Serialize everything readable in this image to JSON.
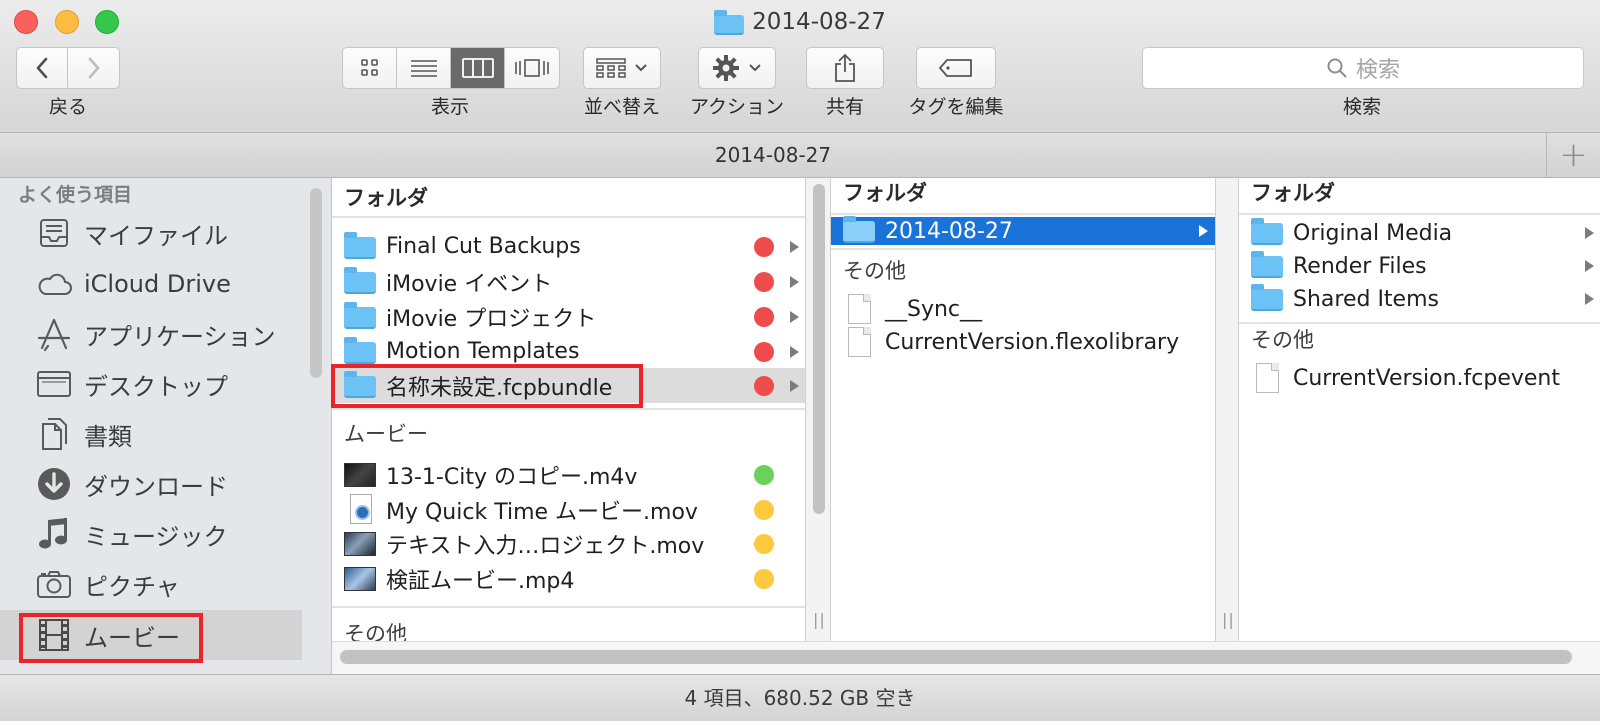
{
  "window": {
    "title": "2014-08-27"
  },
  "toolbar": {
    "back_label": "戻る",
    "view_label": "表示",
    "arrange_label": "並べ替え",
    "action_label": "アクション",
    "share_label": "共有",
    "tags_label": "タグを編集",
    "search_label": "検索",
    "search_placeholder": "検索"
  },
  "pathbar": {
    "title": "2014-08-27",
    "add_symbol": "+"
  },
  "sidebar": {
    "section_title": "よく使う項目",
    "items": [
      {
        "label": "マイファイル",
        "icon": "all-files-icon"
      },
      {
        "label": "iCloud Drive",
        "icon": "cloud-icon"
      },
      {
        "label": "アプリケーション",
        "icon": "applications-icon"
      },
      {
        "label": "デスクトップ",
        "icon": "desktop-icon"
      },
      {
        "label": "書類",
        "icon": "documents-icon"
      },
      {
        "label": "ダウンロード",
        "icon": "download-icon"
      },
      {
        "label": "ミュージック",
        "icon": "music-icon"
      },
      {
        "label": "ピクチャ",
        "icon": "camera-icon"
      },
      {
        "label": "ムービー",
        "icon": "film-icon",
        "selected": true
      }
    ]
  },
  "column1": {
    "folders_header": "フォルダ",
    "folders": [
      {
        "name": "Final Cut Backups",
        "tag": "#ee4b4d"
      },
      {
        "name": "iMovie イベント",
        "tag": "#ee4b4d"
      },
      {
        "name": "iMovie プロジェクト",
        "tag": "#ee4b4d"
      },
      {
        "name": "Motion Templates",
        "tag": "#ee4b4d"
      },
      {
        "name": "名称未設定.fcpbundle",
        "tag": "#ee4b4d",
        "highlighted": true
      }
    ],
    "movies_header": "ムービー",
    "movies": [
      {
        "name": "13-1-City のコピー.m4v",
        "tag": "#6bd15a"
      },
      {
        "name": "My Quick Time ムービー.mov",
        "tag": "#fcc93f"
      },
      {
        "name": "テキスト入力…ロジェクト.mov",
        "tag": "#fcc93f"
      },
      {
        "name": "検証ムービー.mp4",
        "tag": "#fcc93f"
      }
    ],
    "other_header": "その他"
  },
  "column2": {
    "folders_header": "フォルダ",
    "folders": [
      {
        "name": "2014-08-27",
        "selected": true
      }
    ],
    "other_header": "その他",
    "files": [
      {
        "name": "__Sync__"
      },
      {
        "name": "CurrentVersion.flexolibrary"
      }
    ]
  },
  "column3": {
    "folders_header": "フォルダ",
    "folders": [
      {
        "name": "Original Media"
      },
      {
        "name": "Render Files"
      },
      {
        "name": "Shared Items"
      }
    ],
    "other_header": "その他",
    "files": [
      {
        "name": "CurrentVersion.fcpevent"
      }
    ]
  },
  "statusbar": {
    "text": "4 項目、680.52 GB 空き"
  },
  "colors": {
    "selection": "#1a73d9",
    "highlight_box": "#e9242a",
    "tag_red": "#ee4b4d",
    "tag_green": "#6bd15a",
    "tag_yellow": "#fcc93f"
  }
}
